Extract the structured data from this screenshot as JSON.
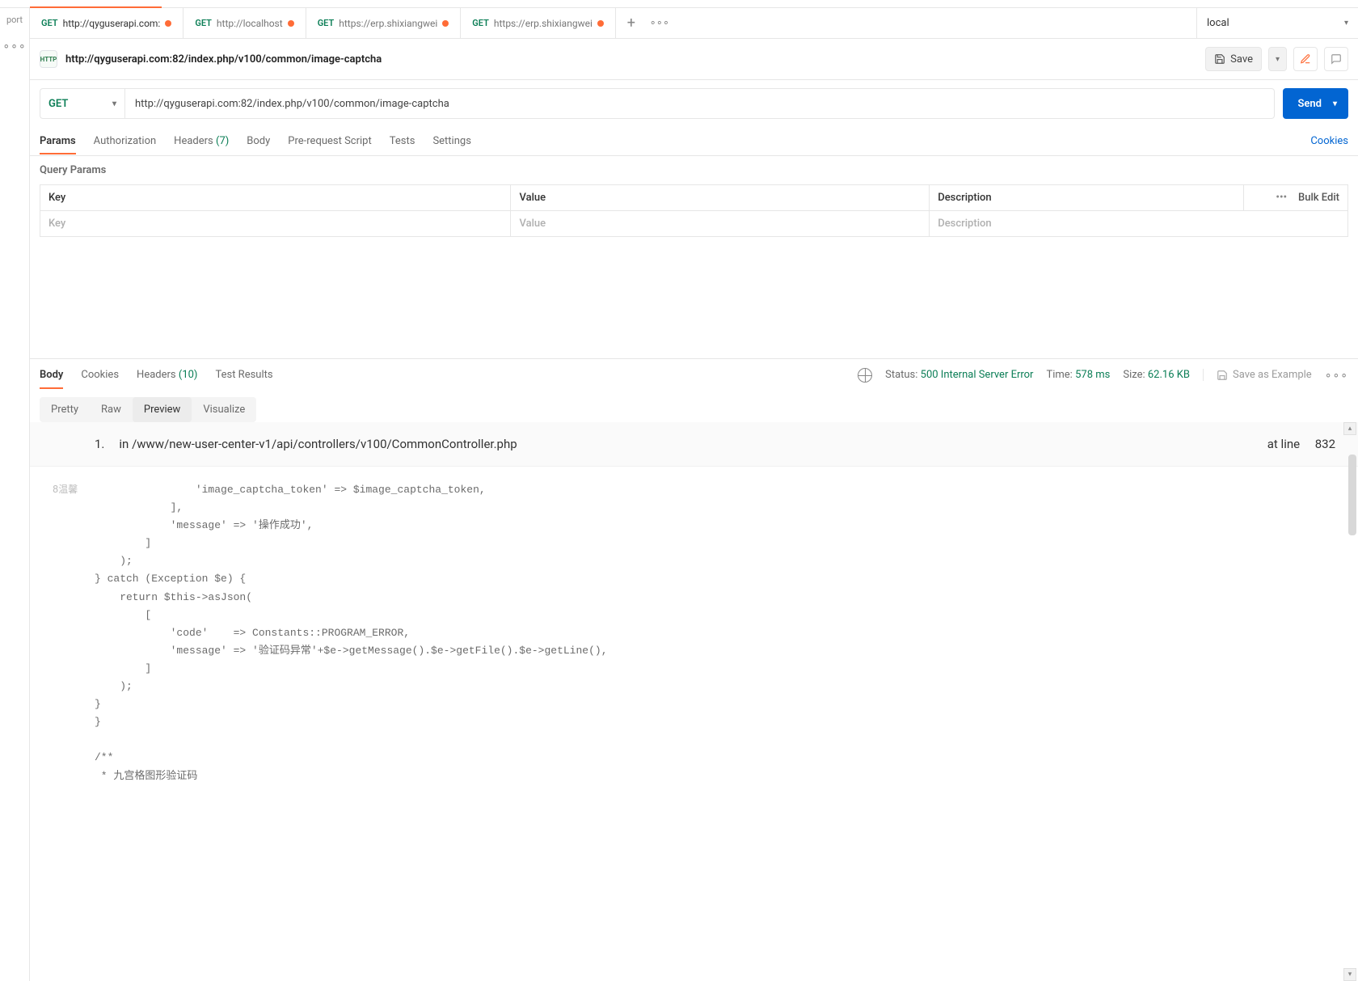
{
  "leftSidebar": {
    "topLabel": "port"
  },
  "tabs": [
    {
      "method": "GET",
      "title": "http://qyguserapi.com:",
      "dirty": true,
      "active": true
    },
    {
      "method": "GET",
      "title": "http://localhost",
      "dirty": true,
      "active": false
    },
    {
      "method": "GET",
      "title": "https://erp.shixiangwei",
      "dirty": true,
      "active": false
    },
    {
      "method": "GET",
      "title": "https://erp.shixiangwei",
      "dirty": true,
      "active": false
    }
  ],
  "environment": {
    "name": "local"
  },
  "request": {
    "title": "http://qyguserapi.com:82/index.php/v100/common/image-captcha",
    "method": "GET",
    "url": "http://qyguserapi.com:82/index.php/v100/common/image-captcha",
    "saveLabel": "Save",
    "sendLabel": "Send"
  },
  "reqTabs": {
    "params": "Params",
    "authorization": "Authorization",
    "headers": "Headers",
    "headersCount": "(7)",
    "body": "Body",
    "preRequest": "Pre-request Script",
    "tests": "Tests",
    "settings": "Settings",
    "cookies": "Cookies"
  },
  "queryParams": {
    "section": "Query Params",
    "headers": {
      "key": "Key",
      "value": "Value",
      "description": "Description",
      "bulkEdit": "Bulk Edit"
    },
    "placeholders": {
      "key": "Key",
      "value": "Value",
      "description": "Description"
    }
  },
  "respTabs": {
    "body": "Body",
    "cookies": "Cookies",
    "headers": "Headers",
    "headersCount": "(10)",
    "testResults": "Test Results"
  },
  "respStatus": {
    "statusLabel": "Status:",
    "statusValue": "500 Internal Server Error",
    "timeLabel": "Time:",
    "timeValue": "578 ms",
    "sizeLabel": "Size:",
    "sizeValue": "62.16 KB",
    "saveExample": "Save as Example"
  },
  "viewModes": {
    "pretty": "Pretty",
    "raw": "Raw",
    "preview": "Preview",
    "visualize": "Visualize"
  },
  "error": {
    "index": "1.",
    "prefix": "in",
    "path": "/www/new-user-center-v1/api/controllers/v100/CommonController.php",
    "atLineLabel": "at line",
    "lineNo": "832",
    "sideLabel": "8温馨",
    "code": "                'image_captcha_token' => $image_captcha_token,\n            ],\n            'message' => '操作成功',\n        ]\n    );\n} catch (Exception $e) {\n    return $this->asJson(\n        [\n            'code'    => Constants::PROGRAM_ERROR,\n            'message' => '验证码异常'+$e->getMessage().$e->getFile().$e->getLine(),\n        ]\n    );\n}\n}\n\n/**\n * 九宫格图形验证码"
  }
}
